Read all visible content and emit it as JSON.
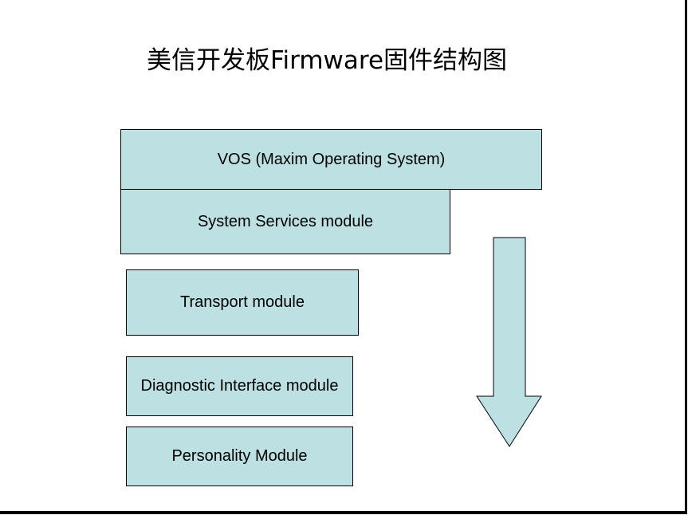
{
  "title": "美信开发板Firmware固件结构图",
  "colors": {
    "box_fill": "#bde0e2",
    "border": "#000000",
    "background": "#ffffff"
  },
  "layers": [
    {
      "label": "VOS (Maxim Operating System)"
    },
    {
      "label": "System Services module"
    },
    {
      "label": "Transport module"
    },
    {
      "label": "Diagnostic Interface module"
    },
    {
      "label": "Personality Module"
    }
  ],
  "arrow": {
    "direction": "down",
    "icon": "down-arrow-icon"
  }
}
